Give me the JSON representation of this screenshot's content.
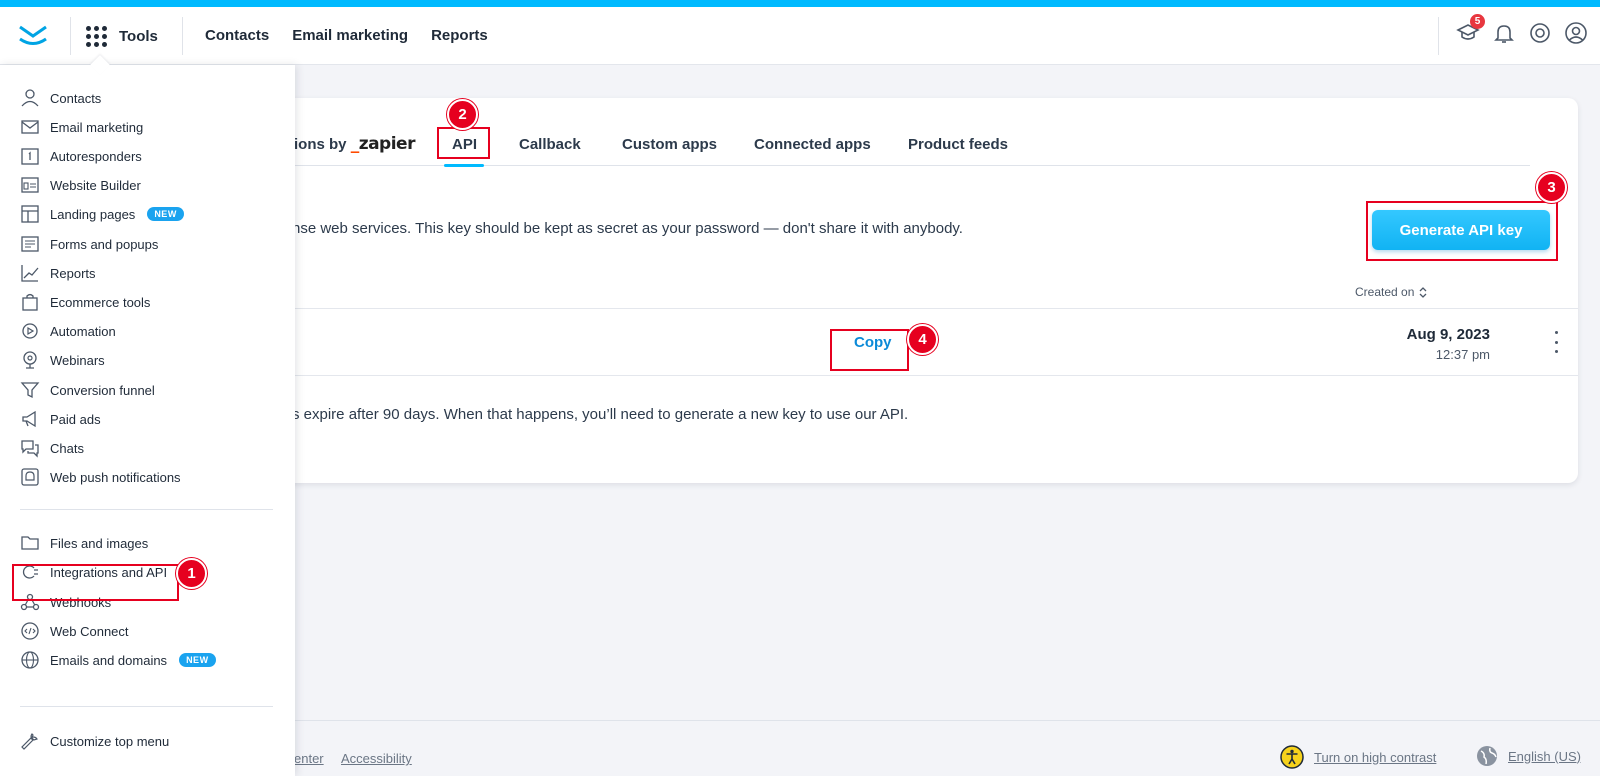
{
  "topbar": {
    "tools_label": "Tools",
    "nav": [
      "Contacts",
      "Email marketing",
      "Reports"
    ],
    "notification_count": "5"
  },
  "menu": {
    "items": [
      {
        "label": "Contacts",
        "icon": "person-icon"
      },
      {
        "label": "Email marketing",
        "icon": "envelope-icon"
      },
      {
        "label": "Autoresponders",
        "icon": "calendar-icon"
      },
      {
        "label": "Website Builder",
        "icon": "website-icon"
      },
      {
        "label": "Landing pages",
        "icon": "layout-icon",
        "badge": "NEW"
      },
      {
        "label": "Forms and popups",
        "icon": "form-icon"
      },
      {
        "label": "Reports",
        "icon": "chart-icon"
      },
      {
        "label": "Ecommerce tools",
        "icon": "bag-icon"
      },
      {
        "label": "Automation",
        "icon": "automation-icon"
      },
      {
        "label": "Webinars",
        "icon": "webcam-icon"
      },
      {
        "label": "Conversion funnel",
        "icon": "funnel-icon"
      },
      {
        "label": "Paid ads",
        "icon": "megaphone-icon"
      },
      {
        "label": "Chats",
        "icon": "chat-icon"
      },
      {
        "label": "Web push notifications",
        "icon": "bell-icon"
      }
    ],
    "items2": [
      {
        "label": "Files and images",
        "icon": "folder-icon"
      },
      {
        "label": "Integrations and API",
        "icon": "plug-icon"
      },
      {
        "label": "Webhooks",
        "icon": "webhook-icon"
      },
      {
        "label": "Web Connect",
        "icon": "code-icon"
      },
      {
        "label": "Emails and domains",
        "icon": "globe-icon",
        "badge": "NEW"
      }
    ],
    "customize": "Customize top menu"
  },
  "tabs": {
    "integrations_partial": "ions by",
    "zapier": "zapier",
    "api": "API",
    "callback": "Callback",
    "custom_apps": "Custom apps",
    "connected_apps": "Connected apps",
    "product_feeds": "Product feeds"
  },
  "api_page": {
    "description": "nse web services. This key should be kept as secret as your password — don't share it with anybody.",
    "generate_button": "Generate API key",
    "created_on_header": "Created on",
    "copy_label": "Copy",
    "created_date": "Aug 9, 2023",
    "created_time": "12:37 pm",
    "expire_note": "s expire after 90 days. When that happens, you’ll need to generate a new key to use our API."
  },
  "footer": {
    "center_partial": "enter",
    "accessibility": "Accessibility",
    "high_contrast": "Turn on high contrast",
    "language": "English (US)"
  },
  "annotations": [
    "1",
    "2",
    "3",
    "4"
  ],
  "colors": {
    "accent": "#00baff",
    "annotation_red": "#e6001f",
    "link_blue": "#0b8ad8",
    "badge_blue": "#1aa3ef"
  }
}
